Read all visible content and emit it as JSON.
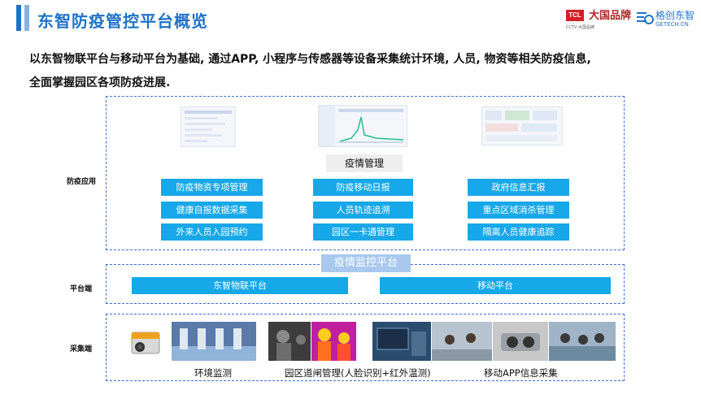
{
  "header": {
    "title": "东智防疫管控平台概览",
    "logos": {
      "tcl": "TCL",
      "brand_script": "大国品牌",
      "brand_caption": "CCTV·大国品牌",
      "geetech_name": "格创东智",
      "geetech_url": "GETECH.CN"
    }
  },
  "description": {
    "line1": "以东智物联平台与移动平台为基础, 通过APP, 小程序与传感器等设备采集统计环境, 人员, 物资等相关防疫信息,",
    "line2": "全面掌握园区各项防疫进展."
  },
  "sections": {
    "app": {
      "label": "防疫应用",
      "center_box": "疫情管理",
      "col1": [
        "防疫物资专项管理",
        "健康自报数据采集",
        "外来人员入园预约"
      ],
      "col2": [
        "防疫移动日报",
        "人员轨迹追溯",
        "园区一卡通管理"
      ],
      "col3": [
        "政府信息汇报",
        "重点区域消杀管理",
        "隔离人员健康追踪"
      ]
    },
    "monitor_title": "疫情监控平台",
    "platform": {
      "label": "平台端",
      "left": "东智物联平台",
      "right": "移动平台"
    },
    "collect": {
      "label": "采集端",
      "captions": [
        "环境监测",
        "园区道闸管理(人脸识别+红外温测)",
        "移动APP信息采集"
      ]
    }
  },
  "colors": {
    "accent": "#1f73c7",
    "button": "#16a8e8",
    "dashed_border": "#3b6fd4",
    "overlay": "#a8c8ee"
  }
}
